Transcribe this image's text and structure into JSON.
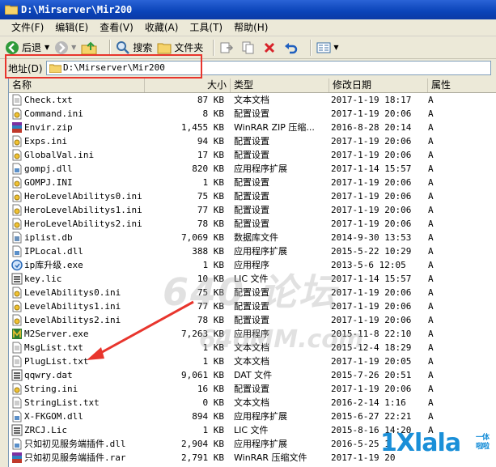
{
  "window": {
    "title": "D:\\Mirserver\\Mir200"
  },
  "menu": [
    "文件(F)",
    "编辑(E)",
    "查看(V)",
    "收藏(A)",
    "工具(T)",
    "帮助(H)"
  ],
  "toolbar": {
    "back": "后退",
    "search": "搜索",
    "folders": "文件夹"
  },
  "address": {
    "label": "地址(D)",
    "value": "D:\\Mirserver\\Mir200"
  },
  "columns": {
    "name": "名称",
    "size": "大小",
    "type": "类型",
    "modified": "修改日期",
    "attr": "属性"
  },
  "files": [
    {
      "name": "Check.txt",
      "size": "87 KB",
      "type": "文本文档",
      "date": "2017-1-19 18:17",
      "attr": "A",
      "icon": "text-file-icon"
    },
    {
      "name": "Command.ini",
      "size": "8 KB",
      "type": "配置设置",
      "date": "2017-1-19 20:06",
      "attr": "A",
      "icon": "ini-file-icon"
    },
    {
      "name": "Envir.zip",
      "size": "1,455 KB",
      "type": "WinRAR ZIP 压缩...",
      "date": "2016-8-28 20:14",
      "attr": "A",
      "icon": "rar-archive-icon"
    },
    {
      "name": "Exps.ini",
      "size": "94 KB",
      "type": "配置设置",
      "date": "2017-1-19 20:06",
      "attr": "A",
      "icon": "ini-file-icon"
    },
    {
      "name": "GlobalVal.ini",
      "size": "17 KB",
      "type": "配置设置",
      "date": "2017-1-19 20:06",
      "attr": "A",
      "icon": "ini-file-icon"
    },
    {
      "name": "gompj.dll",
      "size": "820 KB",
      "type": "应用程序扩展",
      "date": "2017-1-14 15:57",
      "attr": "A",
      "icon": "dll-file-icon"
    },
    {
      "name": "GOMPJ.INI",
      "size": "1 KB",
      "type": "配置设置",
      "date": "2017-1-19 20:06",
      "attr": "A",
      "icon": "ini-file-icon"
    },
    {
      "name": "HeroLevelAbilitys0.ini",
      "size": "75 KB",
      "type": "配置设置",
      "date": "2017-1-19 20:06",
      "attr": "A",
      "icon": "ini-file-icon"
    },
    {
      "name": "HeroLevelAbilitys1.ini",
      "size": "77 KB",
      "type": "配置设置",
      "date": "2017-1-19 20:06",
      "attr": "A",
      "icon": "ini-file-icon"
    },
    {
      "name": "HeroLevelAbilitys2.ini",
      "size": "78 KB",
      "type": "配置设置",
      "date": "2017-1-19 20:06",
      "attr": "A",
      "icon": "ini-file-icon"
    },
    {
      "name": "iplist.db",
      "size": "7,069 KB",
      "type": "数据库文件",
      "date": "2014-9-30 13:53",
      "attr": "A",
      "icon": "db-file-icon"
    },
    {
      "name": "IPLocal.dll",
      "size": "388 KB",
      "type": "应用程序扩展",
      "date": "2015-5-22 10:29",
      "attr": "A",
      "icon": "dll-file-icon"
    },
    {
      "name": "ip库升级.exe",
      "size": "1 KB",
      "type": "应用程序",
      "date": "2013-5-6 12:05",
      "attr": "A",
      "icon": "exe-app-icon"
    },
    {
      "name": "key.lic",
      "size": "10 KB",
      "type": "LIC 文件",
      "date": "2017-1-14 15:57",
      "attr": "A",
      "icon": "lic-file-icon"
    },
    {
      "name": "LevelAbilitys0.ini",
      "size": "75 KB",
      "type": "配置设置",
      "date": "2017-1-19 20:06",
      "attr": "A",
      "icon": "ini-file-icon"
    },
    {
      "name": "LevelAbilitys1.ini",
      "size": "77 KB",
      "type": "配置设置",
      "date": "2017-1-19 20:06",
      "attr": "A",
      "icon": "ini-file-icon"
    },
    {
      "name": "LevelAbilitys2.ini",
      "size": "78 KB",
      "type": "配置设置",
      "date": "2017-1-19 20:06",
      "attr": "A",
      "icon": "ini-file-icon"
    },
    {
      "name": "M2Server.exe",
      "size": "7,263 KB",
      "type": "应用程序",
      "date": "2015-11-8 22:10",
      "attr": "A",
      "icon": "m2server-exe-icon"
    },
    {
      "name": "MsgList.txt",
      "size": "1 KB",
      "type": "文本文档",
      "date": "2015-12-4 18:29",
      "attr": "A",
      "icon": "text-file-icon"
    },
    {
      "name": "PlugList.txt",
      "size": "1 KB",
      "type": "文本文档",
      "date": "2017-1-19 20:05",
      "attr": "A",
      "icon": "text-file-icon"
    },
    {
      "name": "qqwry.dat",
      "size": "9,061 KB",
      "type": "DAT 文件",
      "date": "2015-7-26 20:51",
      "attr": "A",
      "icon": "dat-file-icon"
    },
    {
      "name": "String.ini",
      "size": "16 KB",
      "type": "配置设置",
      "date": "2017-1-19 20:06",
      "attr": "A",
      "icon": "ini-file-icon"
    },
    {
      "name": "StringList.txt",
      "size": "0 KB",
      "type": "文本文档",
      "date": "2016-2-14 1:16",
      "attr": "A",
      "icon": "text-file-icon"
    },
    {
      "name": "X-FKGOM.dll",
      "size": "894 KB",
      "type": "应用程序扩展",
      "date": "2015-6-27 22:21",
      "attr": "A",
      "icon": "dll-file-icon"
    },
    {
      "name": "ZRCJ.Lic",
      "size": "1 KB",
      "type": "LIC 文件",
      "date": "2015-8-16 14:20",
      "attr": "A",
      "icon": "lic-file-icon"
    },
    {
      "name": "只如初见服务端插件.dll",
      "size": "2,904 KB",
      "type": "应用程序扩展",
      "date": "2016-5-25 1",
      "attr": "",
      "icon": "dll-file-icon"
    },
    {
      "name": "只如初见服务端插件.rar",
      "size": "2,791 KB",
      "type": "WinRAR 压缩文件",
      "date": "2017-1-19 20",
      "attr": "",
      "icon": "rar-archive-icon"
    }
  ],
  "watermark": {
    "text1": "640",
    "text2": "论坛",
    "text3": "64oMM.com"
  },
  "logo": {
    "text": "1Xlala",
    "sub": "一体 啦啦"
  },
  "colors": {
    "titlebar": "#0a43b8",
    "highlight": "#e8352d",
    "logo": "#1a8fd8"
  }
}
